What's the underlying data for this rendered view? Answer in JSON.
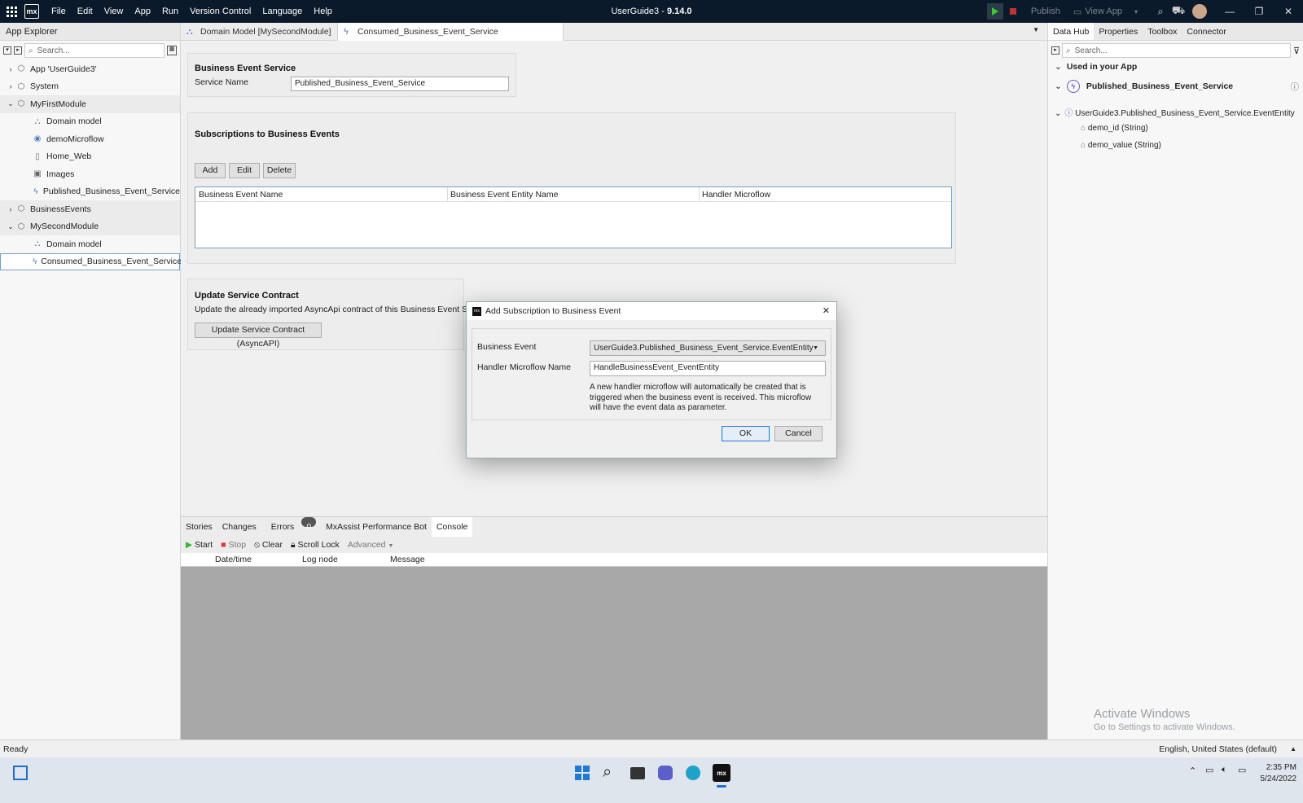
{
  "titlebar": {
    "menu": [
      "File",
      "Edit",
      "View",
      "App",
      "Run",
      "Version Control",
      "Language",
      "Help"
    ],
    "app_name": "UserGuide3",
    "version": "9.14.0",
    "separator": " - ",
    "publish": "Publish",
    "view_app": "View App",
    "logo": "mx"
  },
  "app_explorer": {
    "title": "App Explorer",
    "search_placeholder": "Search...",
    "items": [
      {
        "label": "App 'UserGuide3'"
      },
      {
        "label": "System"
      },
      {
        "label": "MyFirstModule"
      },
      {
        "label": "Domain model"
      },
      {
        "label": "demoMicroflow"
      },
      {
        "label": "Home_Web"
      },
      {
        "label": "Images"
      },
      {
        "label": "Published_Business_Event_Service"
      },
      {
        "label": "BusinessEvents"
      },
      {
        "label": "MySecondModule"
      },
      {
        "label": "Domain model"
      },
      {
        "label": "Consumed_Business_Event_Service"
      }
    ]
  },
  "tabs": [
    {
      "label": "Domain Model [MySecondModule]"
    },
    {
      "label": "Consumed_Business_Event_Service [MySecondModule]"
    }
  ],
  "editor": {
    "service": {
      "heading": "Business Event Service",
      "name_label": "Service Name",
      "name_value": "Published_Business_Event_Service"
    },
    "subscriptions": {
      "heading": "Subscriptions to Business Events",
      "add": "Add",
      "edit": "Edit",
      "delete": "Delete",
      "columns": [
        "Business Event Name",
        "Business Event Entity Name",
        "Handler Microflow"
      ]
    },
    "contract": {
      "heading": "Update Service Contract",
      "description": "Update the already imported AsyncApi contract of this Business Event Service.",
      "button": "Update Service Contract (AsyncAPI)"
    }
  },
  "dialog": {
    "title": "Add Subscription to Business Event",
    "event_label": "Business Event",
    "event_value": "UserGuide3.Published_Business_Event_Service.EventEntity",
    "handler_label": "Handler Microflow Name",
    "handler_value": "HandleBusinessEvent_EventEntity",
    "help": "A new handler microflow will automatically be created that is triggered when the business event is received. This microflow will have the event data as parameter.",
    "ok": "OK",
    "cancel": "Cancel"
  },
  "bottom": {
    "tabs": [
      "Stories",
      "Changes",
      "Errors",
      "MxAssist Performance Bot",
      "Console"
    ],
    "errors_count": "0",
    "toolbar": {
      "start": "Start",
      "stop": "Stop",
      "clear": "Clear",
      "scroll_lock": "Scroll Lock",
      "advanced": "Advanced"
    },
    "columns": [
      "Date/time",
      "Log node",
      "Message"
    ]
  },
  "right_panel": {
    "tabs": [
      "Data Hub",
      "Properties",
      "Toolbox",
      "Connector"
    ],
    "search_placeholder": "Search...",
    "section": "Used in your App",
    "service": "Published_Business_Event_Service",
    "entity": "UserGuide3.Published_Business_Event_Service.EventEntity",
    "attributes": [
      "demo_id (String)",
      "demo_value (String)"
    ]
  },
  "statusbar": {
    "status": "Ready",
    "language": "English, United States (default)"
  },
  "watermark": {
    "title": "Activate Windows",
    "subtitle": "Go to Settings to activate Windows."
  },
  "taskbar": {
    "time": "2:35 PM",
    "date": "5/24/2022"
  }
}
